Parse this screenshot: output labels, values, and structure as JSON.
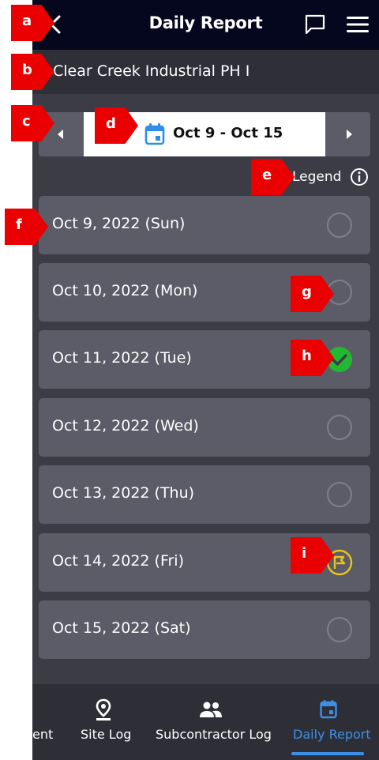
{
  "header": {
    "title": "Daily Report",
    "back_icon": "chevron-left-icon",
    "chat_icon": "chat-bubble-icon",
    "menu_icon": "hamburger-menu-icon"
  },
  "project": {
    "name": "Clear Creek Industrial PH I"
  },
  "week": {
    "range": "Oct 9 - Oct 15",
    "calendar_icon": "calendar-icon"
  },
  "legend": {
    "label": "Legend",
    "icon": "info-icon"
  },
  "days": [
    {
      "date": "Oct 9, 2022 (Sun)",
      "status": "empty"
    },
    {
      "date": "Oct 10, 2022 (Mon)",
      "status": "empty"
    },
    {
      "date": "Oct 11, 2022 (Tue)",
      "status": "complete"
    },
    {
      "date": "Oct 12, 2022 (Wed)",
      "status": "empty"
    },
    {
      "date": "Oct 13, 2022 (Thu)",
      "status": "empty"
    },
    {
      "date": "Oct 14, 2022 (Fri)",
      "status": "flagged"
    },
    {
      "date": "Oct 15, 2022 (Sat)",
      "status": "empty"
    }
  ],
  "bottom_nav": {
    "tabs": [
      {
        "label": "ent",
        "icon": "",
        "active": false
      },
      {
        "label": "Site Log",
        "icon": "location-pin-icon",
        "active": false
      },
      {
        "label": "Subcontractor Log",
        "icon": "people-icon",
        "active": false
      },
      {
        "label": "Daily Report",
        "icon": "calendar-icon",
        "active": true
      }
    ]
  },
  "annotations": [
    "a",
    "b",
    "c",
    "d",
    "e",
    "f",
    "g",
    "h",
    "i"
  ],
  "colors": {
    "accent": "#3d8fe6",
    "complete": "#22b830",
    "flagged": "#e6c51c",
    "marker": "#ea0000",
    "header_bg": "#05071e",
    "panel_bg": "#3b3c45",
    "row_bg": "#5b5c68"
  }
}
